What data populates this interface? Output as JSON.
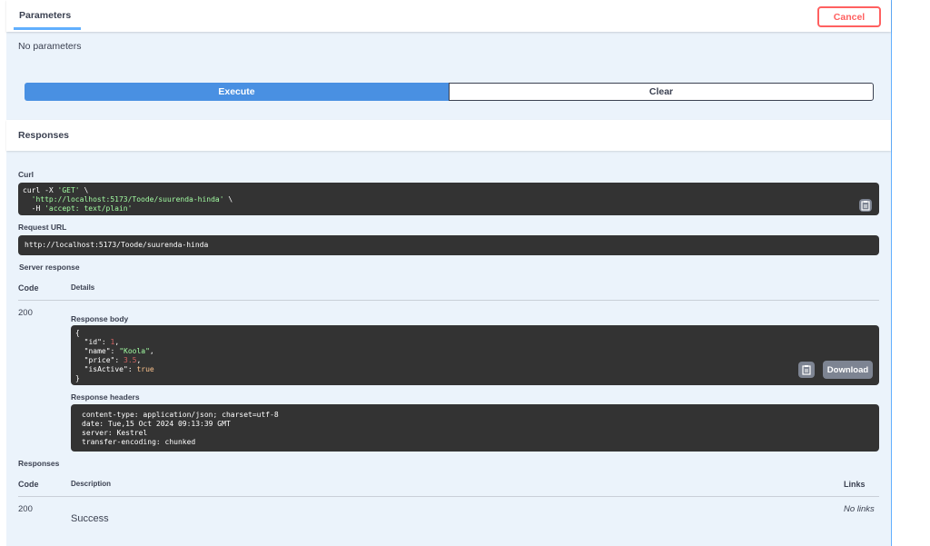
{
  "parameters": {
    "tab_label": "Parameters",
    "cancel_label": "Cancel",
    "no_params_text": "No parameters"
  },
  "actions": {
    "execute_label": "Execute",
    "clear_label": "Clear"
  },
  "responses_section": {
    "title": "Responses"
  },
  "curl": {
    "label": "Curl",
    "line1_prefix": "curl -X ",
    "line1_method": "'GET'",
    "line1_suffix": " \\",
    "line2_url": "'http://localhost:5173/Toode/suurenda-hinda'",
    "line2_suffix": " \\",
    "line3_prefix": "  -H ",
    "line3_header": "'accept: text/plain'"
  },
  "request_url": {
    "label": "Request URL",
    "value": "http://localhost:5173/Toode/suurenda-hinda"
  },
  "server_response": {
    "label": "Server response",
    "col_code": "Code",
    "col_details": "Details",
    "code": "200",
    "body_label": "Response body",
    "body": {
      "open": "{",
      "close": "}",
      "id_key": "\"id\"",
      "id_val": "1",
      "name_key": "\"name\"",
      "name_val": "\"Koola\"",
      "price_key": "\"price\"",
      "price_val": "3.5",
      "active_key": "\"isActive\"",
      "active_val": "true"
    },
    "download_label": "Download",
    "headers_label": "Response headers",
    "headers": [
      "content-type: application/json; charset=utf-8",
      "date: Tue,15 Oct 2024 09:13:39 GMT",
      "server: Kestrel",
      "transfer-encoding: chunked"
    ]
  },
  "responses_table": {
    "label": "Responses",
    "col_code": "Code",
    "col_description": "Description",
    "col_links": "Links",
    "rows": [
      {
        "code": "200",
        "description": "Success",
        "links": "No links"
      }
    ]
  },
  "colors": {
    "accent": "#61affe",
    "execute": "#4990e2",
    "cancel": "#ff6060",
    "code_bg": "#333333"
  }
}
